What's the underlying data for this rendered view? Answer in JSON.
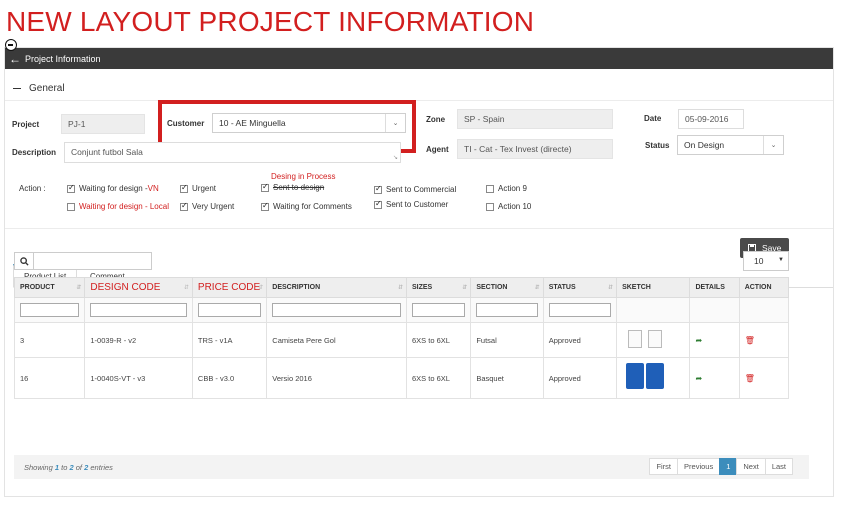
{
  "banner": "NEW LAYOUT PROJECT INFORMATION",
  "header": {
    "title": "Project Information"
  },
  "general": {
    "title": "General"
  },
  "form": {
    "project_label": "Project",
    "project_value": "PJ-1",
    "customer_label": "Customer",
    "customer_value": "10 - AE Minguella",
    "zone_label": "Zone",
    "zone_value": "SP - Spain",
    "date_label": "Date",
    "date_value": "05-09-2016",
    "description_label": "Description",
    "description_value": "Conjunt futbol Sala",
    "agent_label": "Agent",
    "agent_value": "TI - Cat - Tex Invest (directe)",
    "status_label": "Status",
    "status_value": "On Design"
  },
  "actions": {
    "label": "Action :",
    "annotation": "Desing in Process",
    "items": [
      {
        "label": "Waiting for design - ",
        "suffix": "VN",
        "checked": true
      },
      {
        "label": "Waiting for design - Local",
        "checked": false
      },
      {
        "label": "Urgent",
        "checked": true
      },
      {
        "label": "Very Urgent",
        "checked": true
      },
      {
        "label": "Sent to design",
        "checked": true
      },
      {
        "label": "Waiting for Comments",
        "checked": true
      },
      {
        "label": "Sent to Commercial",
        "checked": true
      },
      {
        "label": "Sent to Customer",
        "checked": true
      },
      {
        "label": "Action 9",
        "checked": false
      },
      {
        "label": "Action 10",
        "checked": false
      }
    ]
  },
  "save_label": "Save",
  "tabs": [
    "Product List",
    "Comment"
  ],
  "page_length": "10",
  "table": {
    "columns": [
      "PRODUCT",
      "DESIGN CODE",
      "PRICE CODE",
      "DESCRIPTION",
      "SIZES",
      "SECTION",
      "STATUS",
      "SKETCH",
      "DETAILS",
      "ACTION"
    ],
    "rows": [
      {
        "product": "3",
        "design_code": "1-0039-R - v2",
        "price_code": "TRS - v1A",
        "description": "Camiseta Pere Gol",
        "sizes": "6XS to 6XL",
        "section": "Futsal",
        "status": "Approved"
      },
      {
        "product": "16",
        "design_code": "1-0040S-VT - v3",
        "price_code": "CBB - v3.0",
        "description": "Versio 2016",
        "sizes": "6XS to 6XL",
        "section": "Basquet",
        "status": "Approved"
      }
    ]
  },
  "footer": {
    "showing": "Showing",
    "from": "1",
    "to_word": "to",
    "to": "2",
    "of_word": "of",
    "total": "2",
    "entries": "entries"
  },
  "pagination": [
    "First",
    "Previous",
    "1",
    "Next",
    "Last"
  ],
  "colors": {
    "accent": "#3c8dbc",
    "highlight_red": "#d21f1f",
    "header_bg": "#3a3a3a"
  }
}
